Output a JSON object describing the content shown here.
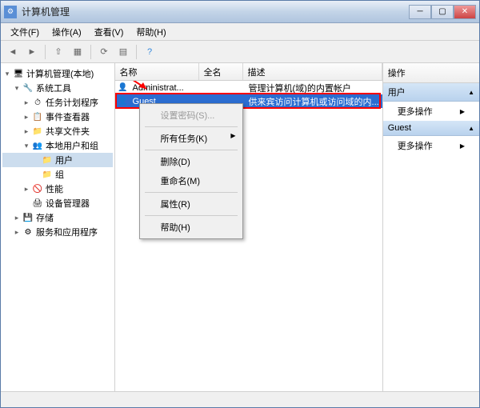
{
  "window": {
    "title": "计算机管理"
  },
  "menu": {
    "file": "文件(F)",
    "action": "操作(A)",
    "view": "查看(V)",
    "help": "帮助(H)"
  },
  "tree": {
    "root": "计算机管理(本地)",
    "sys_tools": "系统工具",
    "task_sched": "任务计划程序",
    "event_viewer": "事件查看器",
    "shared": "共享文件夹",
    "local_users": "本地用户和组",
    "users": "用户",
    "groups": "组",
    "perf": "性能",
    "devmgr": "设备管理器",
    "storage": "存储",
    "services": "服务和应用程序"
  },
  "list": {
    "col_name": "名称",
    "col_fullname": "全名",
    "col_desc": "描述",
    "rows": [
      {
        "name": "Administrat...",
        "full": "",
        "desc": "管理计算机(域)的内置帐户"
      },
      {
        "name": "Guest",
        "full": "",
        "desc": "供来宾访问计算机或访问域的内..."
      }
    ]
  },
  "context": {
    "set_password": "设置密码(S)...",
    "all_tasks": "所有任务(K)",
    "delete": "删除(D)",
    "rename": "重命名(M)",
    "properties": "属性(R)",
    "help": "帮助(H)"
  },
  "actions": {
    "header": "操作",
    "group1": "用户",
    "more": "更多操作",
    "group2": "Guest"
  }
}
